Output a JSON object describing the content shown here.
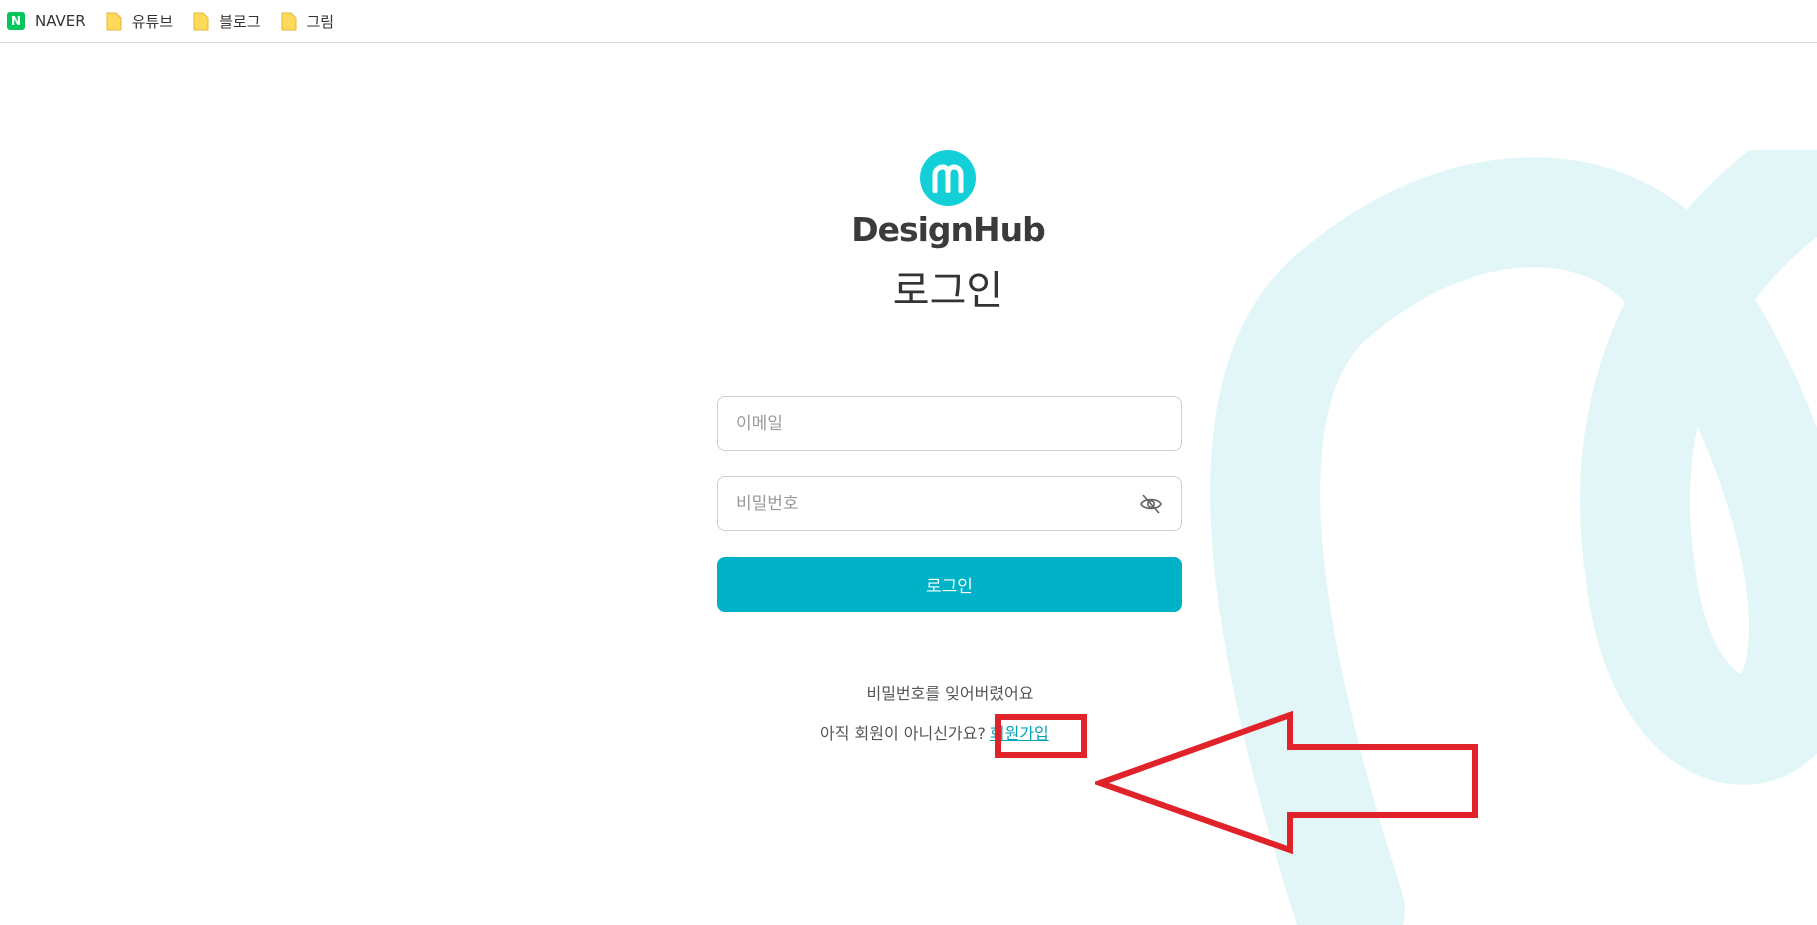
{
  "bookmarks": [
    {
      "label": "NAVER",
      "icon": "naver-icon"
    },
    {
      "label": "유튜브",
      "icon": "folder-icon"
    },
    {
      "label": "블로그",
      "icon": "folder-icon"
    },
    {
      "label": "그림",
      "icon": "folder-icon"
    }
  ],
  "brand": {
    "name": "DesignHub",
    "logo_letter": "m",
    "accent_color": "#12cfd8"
  },
  "login": {
    "title": "로그인",
    "email_placeholder": "이메일",
    "email_value": "",
    "password_placeholder": "비밀번호",
    "password_value": "",
    "submit_label": "로그인",
    "button_color": "#00b2c8",
    "forgot_password": "비밀번호를 잊어버렸어요",
    "signup_prompt": "아직 회원이 아니신가요?",
    "signup_link": "회원가입"
  },
  "annotation": {
    "color": "#e0232b",
    "target": "signup-link"
  }
}
